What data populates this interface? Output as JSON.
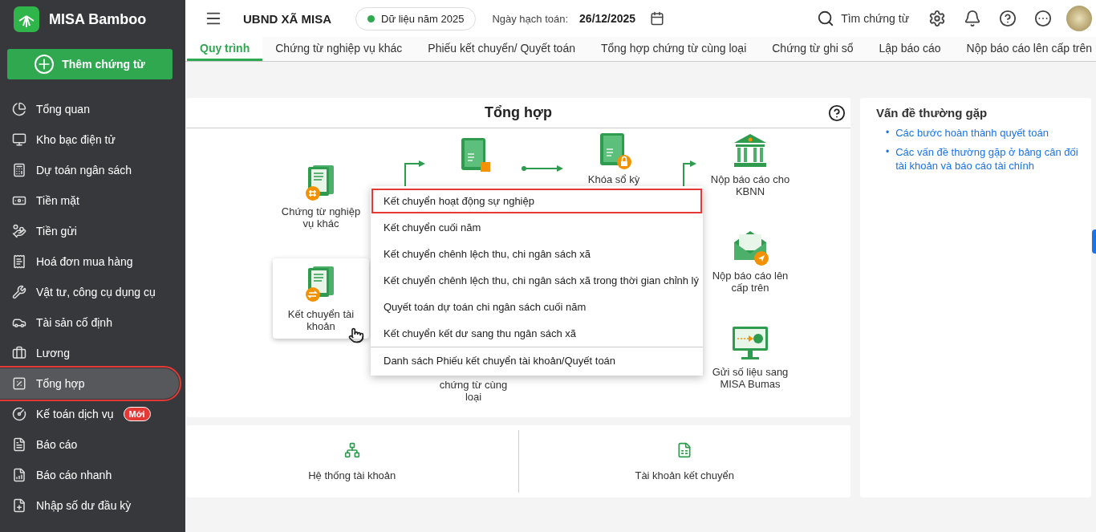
{
  "app": {
    "name": "MISA Bamboo"
  },
  "sidebar": {
    "add_button": "Thêm chứng từ",
    "items": [
      {
        "label": "Tổng quan",
        "selected": false
      },
      {
        "label": "Kho bạc điện tử",
        "selected": false
      },
      {
        "label": "Dự toán ngân sách",
        "selected": false
      },
      {
        "label": "Tiền mặt",
        "selected": false
      },
      {
        "label": "Tiền gửi",
        "selected": false
      },
      {
        "label": "Hoá đơn mua hàng",
        "selected": false
      },
      {
        "label": "Vật tư, công cụ dụng cụ",
        "selected": false
      },
      {
        "label": "Tài sản cố định",
        "selected": false
      },
      {
        "label": "Lương",
        "selected": false
      },
      {
        "label": "Tổng hợp",
        "selected": true
      },
      {
        "label": "Kế toán dịch vụ",
        "selected": false,
        "badge": "Mới"
      },
      {
        "label": "Báo cáo",
        "selected": false
      },
      {
        "label": "Báo cáo nhanh",
        "selected": false
      },
      {
        "label": "Nhập số dư đầu kỳ",
        "selected": false
      }
    ]
  },
  "topbar": {
    "org": "UBND XÃ MISA",
    "data_year": "Dữ liệu năm 2025",
    "posting_date_label": "Ngày hạch toán:",
    "posting_date": "26/12/2025",
    "search": "Tìm chứng từ"
  },
  "tabs": [
    {
      "label": "Quy trình",
      "selected": true
    },
    {
      "label": "Chứng từ nghiệp vụ khác",
      "selected": false
    },
    {
      "label": "Phiếu kết chuyển/ Quyết toán",
      "selected": false
    },
    {
      "label": "Tổng hợp chứng từ cùng loại",
      "selected": false
    },
    {
      "label": "Chứng từ ghi sổ",
      "selected": false
    },
    {
      "label": "Lập báo cáo",
      "selected": false
    },
    {
      "label": "Nộp báo cáo lên cấp trên",
      "selected": false
    }
  ],
  "process": {
    "title": "Tổng hợp",
    "nodes": [
      {
        "kind": "doc",
        "label": "Chứng từ nghiệp vụ khác"
      },
      {
        "kind": "card",
        "label": "Kết chuyển tài khoản",
        "hovered": true
      },
      {
        "kind": "book"
      },
      {
        "kind": "text",
        "label": "chứng từ cùng loại"
      },
      {
        "kind": "book_locked",
        "label": "Khóa sổ kỳ"
      },
      {
        "kind": "bank",
        "label": "Nộp báo cáo cho KBNN"
      },
      {
        "kind": "envelope",
        "label": "Nộp báo cáo lên cấp trên"
      },
      {
        "kind": "monitor",
        "label": "Gửi số liệu sang MISA Bumas"
      }
    ],
    "menu": [
      {
        "kind": "action",
        "label": "Kết chuyển hoạt động sự nghiệp",
        "selected": true
      },
      {
        "kind": "action",
        "label": "Kết chuyển cuối năm",
        "selected": false
      },
      {
        "kind": "action",
        "label": "Kết chuyển chênh lệch thu, chi ngân sách xã",
        "selected": false
      },
      {
        "kind": "action",
        "label": "Kết chuyển chênh lệch thu, chi ngân sách xã trong thời gian chỉnh lý",
        "selected": false
      },
      {
        "kind": "action",
        "label": "Quyết toán dự toán chi ngân sách cuối năm",
        "selected": false
      },
      {
        "kind": "action",
        "label": "Kết chuyển kết dư sang thu ngân sách xã",
        "selected": false
      },
      {
        "kind": "footer",
        "label": "Danh sách Phiếu kết chuyển tài khoản/Quyết toán",
        "selected": false
      }
    ]
  },
  "shortcuts": [
    {
      "label": "Hệ thống tài khoản"
    },
    {
      "label": "Tài khoản kết chuyển"
    }
  ],
  "faq": {
    "title": "Vấn đề thường gặp",
    "links": [
      {
        "bullet": "•",
        "label": "Các bước hoàn thành quyết toán"
      },
      {
        "bullet": "•",
        "label": "Các vấn đề thường gặp ở bảng cân đối tài khoản và báo cáo tài chính"
      }
    ]
  }
}
